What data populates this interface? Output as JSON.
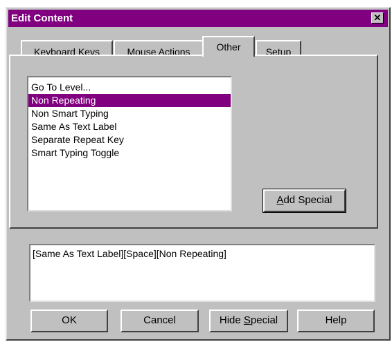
{
  "window": {
    "title": "Edit Content",
    "close_label": "✕"
  },
  "tabs": [
    {
      "label": "Keyboard Keys",
      "active": false
    },
    {
      "label": "Mouse Actions",
      "active": false
    },
    {
      "label": "Other",
      "active": true
    },
    {
      "label": "Setup",
      "active": false
    }
  ],
  "list": {
    "items": [
      "Go To Level...",
      "Non Repeating",
      "Non Smart Typing",
      "Same As Text Label",
      "Separate Repeat Key",
      "Smart Typing Toggle"
    ],
    "selected": "Non Repeating"
  },
  "add_special": {
    "prefix": "",
    "key": "A",
    "rest": "dd Special"
  },
  "content_text": "[Same As Text Label][Space][Non Repeating]",
  "buttons": {
    "ok": "OK",
    "cancel": "Cancel",
    "hide_special": {
      "prefix": "Hide ",
      "key": "S",
      "rest": "pecial"
    },
    "help": "Help"
  },
  "colors": {
    "titlebar": "#800080",
    "selection": "#800080",
    "face": "#c0c0c0"
  }
}
